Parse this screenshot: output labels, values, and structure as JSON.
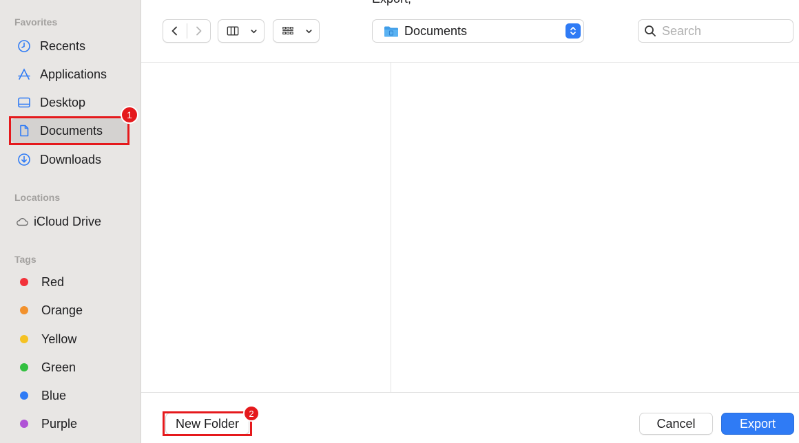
{
  "window": {
    "title_fragment": "Export,",
    "colors": {
      "accent": "#2f7bf5",
      "annotation": "#e5191c",
      "sidebar_bg": "#e8e6e4"
    }
  },
  "sidebar": {
    "favorites_title": "Favorites",
    "favorites": [
      {
        "label": "Recents",
        "icon": "clock-icon"
      },
      {
        "label": "Applications",
        "icon": "applications-icon"
      },
      {
        "label": "Desktop",
        "icon": "desktop-icon"
      },
      {
        "label": "Documents",
        "icon": "document-icon",
        "selected": true
      },
      {
        "label": "Downloads",
        "icon": "download-icon"
      }
    ],
    "locations_title": "Locations",
    "locations": [
      {
        "label": "iCloud Drive",
        "icon": "cloud-icon"
      }
    ],
    "tags_title": "Tags",
    "tags": [
      {
        "label": "Red",
        "color": "#f2323a"
      },
      {
        "label": "Orange",
        "color": "#f2912c"
      },
      {
        "label": "Yellow",
        "color": "#f5c223"
      },
      {
        "label": "Green",
        "color": "#33c040"
      },
      {
        "label": "Blue",
        "color": "#2f7bf5"
      },
      {
        "label": "Purple",
        "color": "#b053d6"
      }
    ]
  },
  "toolbar": {
    "back_icon": "chevron-left-icon",
    "forward_icon": "chevron-right-icon",
    "view_mode_icon": "columns-view-icon",
    "group_icon": "grid-group-icon",
    "location": "Documents",
    "search_placeholder": "Search"
  },
  "annotations": {
    "badge1": "1",
    "badge2": "2"
  },
  "footer": {
    "new_folder": "New Folder",
    "cancel": "Cancel",
    "export": "Export"
  }
}
